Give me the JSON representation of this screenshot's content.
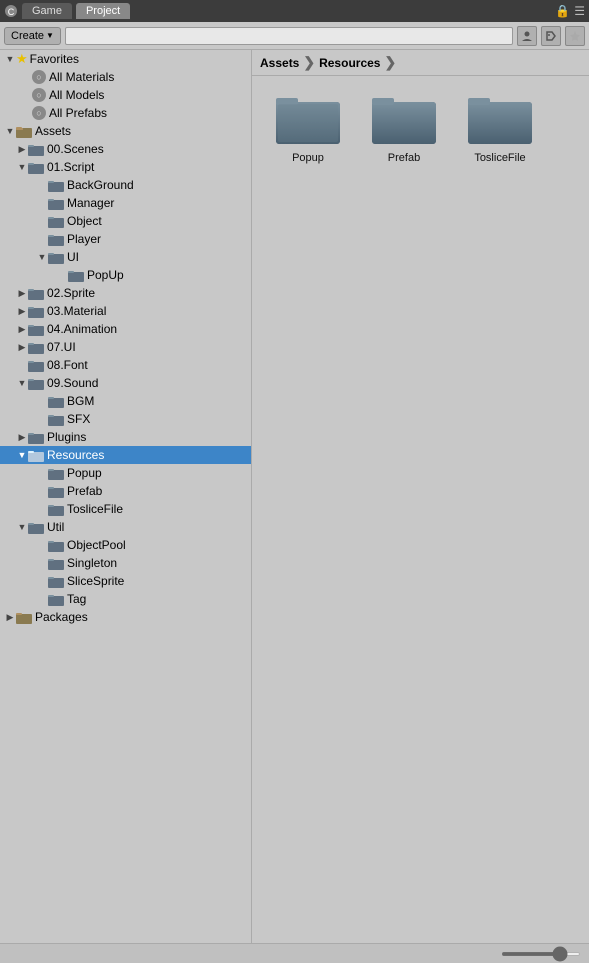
{
  "titleBar": {
    "tabs": [
      {
        "id": "game",
        "label": "Game",
        "active": false
      },
      {
        "id": "project",
        "label": "Project",
        "active": true
      }
    ],
    "lockIcon": "🔒",
    "menuIcon": "☰"
  },
  "toolbar": {
    "createLabel": "Create",
    "searchPlaceholder": "",
    "icons": [
      "person",
      "tag",
      "star"
    ]
  },
  "breadcrumb": {
    "parts": [
      "Assets",
      "Resources"
    ],
    "sep": "❯"
  },
  "tree": {
    "favorites": {
      "label": "Favorites",
      "items": [
        {
          "label": "All Materials"
        },
        {
          "label": "All Models"
        },
        {
          "label": "All Prefabs"
        }
      ]
    },
    "assets": {
      "label": "Assets",
      "children": [
        {
          "label": "00.Scenes",
          "expanded": false
        },
        {
          "label": "01.Script",
          "expanded": true,
          "children": [
            {
              "label": "BackGround"
            },
            {
              "label": "Manager"
            },
            {
              "label": "Object"
            },
            {
              "label": "Player"
            },
            {
              "label": "UI",
              "expanded": true,
              "children": [
                {
                  "label": "PopUp"
                }
              ]
            }
          ]
        },
        {
          "label": "02.Sprite",
          "expanded": false
        },
        {
          "label": "03.Material",
          "expanded": false
        },
        {
          "label": "04.Animation",
          "expanded": false
        },
        {
          "label": "07.UI",
          "expanded": false
        },
        {
          "label": "08.Font",
          "expanded": false
        },
        {
          "label": "09.Sound",
          "expanded": true,
          "children": [
            {
              "label": "BGM"
            },
            {
              "label": "SFX"
            }
          ]
        },
        {
          "label": "Plugins",
          "expanded": false
        },
        {
          "label": "Resources",
          "expanded": true,
          "selected": true,
          "children": [
            {
              "label": "Popup"
            },
            {
              "label": "Prefab"
            },
            {
              "label": "TosliceFile"
            }
          ]
        },
        {
          "label": "Util",
          "expanded": true,
          "children": [
            {
              "label": "ObjectPool"
            },
            {
              "label": "Singleton"
            },
            {
              "label": "SliceSprite"
            },
            {
              "label": "Tag"
            }
          ]
        }
      ]
    },
    "packages": {
      "label": "Packages",
      "expanded": false
    }
  },
  "assets": [
    {
      "label": "Popup"
    },
    {
      "label": "Prefab"
    },
    {
      "label": "TosliceFile"
    }
  ],
  "colors": {
    "selected": "#3d85c8",
    "folderBody": "#607080",
    "folderTop": "#7a909e"
  }
}
